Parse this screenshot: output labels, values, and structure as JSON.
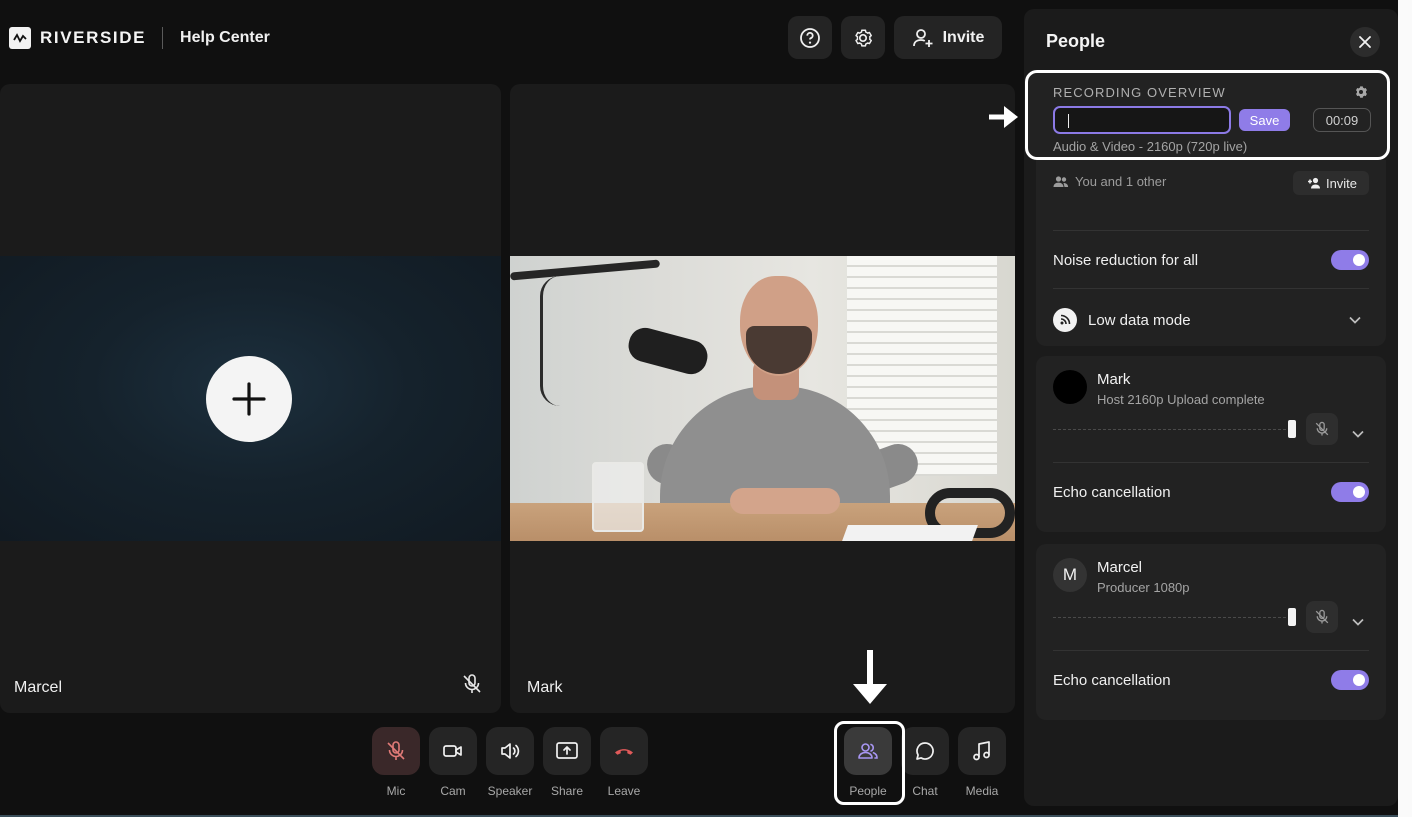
{
  "header": {
    "brand": "RIVERSIDE",
    "subtitle": "Help Center",
    "invite_label": "Invite"
  },
  "tiles": [
    {
      "name": "Marcel",
      "muted": true
    },
    {
      "name": "Mark",
      "muted": false
    }
  ],
  "controls": [
    {
      "label": "Mic",
      "icon": "mic-off-icon"
    },
    {
      "label": "Cam",
      "icon": "camera-icon"
    },
    {
      "label": "Speaker",
      "icon": "speaker-icon"
    },
    {
      "label": "Share",
      "icon": "share-screen-icon"
    },
    {
      "label": "Leave",
      "icon": "phone-hangup-icon"
    },
    {
      "label": "People",
      "icon": "people-icon"
    },
    {
      "label": "Chat",
      "icon": "chat-icon"
    },
    {
      "label": "Media",
      "icon": "music-note-icon"
    }
  ],
  "panel": {
    "title": "People",
    "overview": {
      "title": "RECORDING OVERVIEW",
      "input_value": "",
      "save_label": "Save",
      "timer": "00:09",
      "format": "Audio & Video - 2160p (720p live)"
    },
    "participants_summary": "You and 1 other",
    "invite_label": "Invite",
    "noise_reduction": {
      "label": "Noise reduction for all",
      "enabled": true
    },
    "low_data_mode": {
      "label": "Low data mode"
    },
    "participants": [
      {
        "name": "Mark",
        "initial": "",
        "meta": "Host  2160p  Upload complete",
        "echo_label": "Echo cancellation",
        "echo_enabled": true
      },
      {
        "name": "Marcel",
        "initial": "M",
        "meta": "Producer  1080p",
        "echo_label": "Echo cancellation",
        "echo_enabled": true
      }
    ]
  },
  "colors": {
    "accent": "#8f7ce8",
    "background": "#101010",
    "surface": "#1b1b1b",
    "leave": "#e05a5a"
  }
}
